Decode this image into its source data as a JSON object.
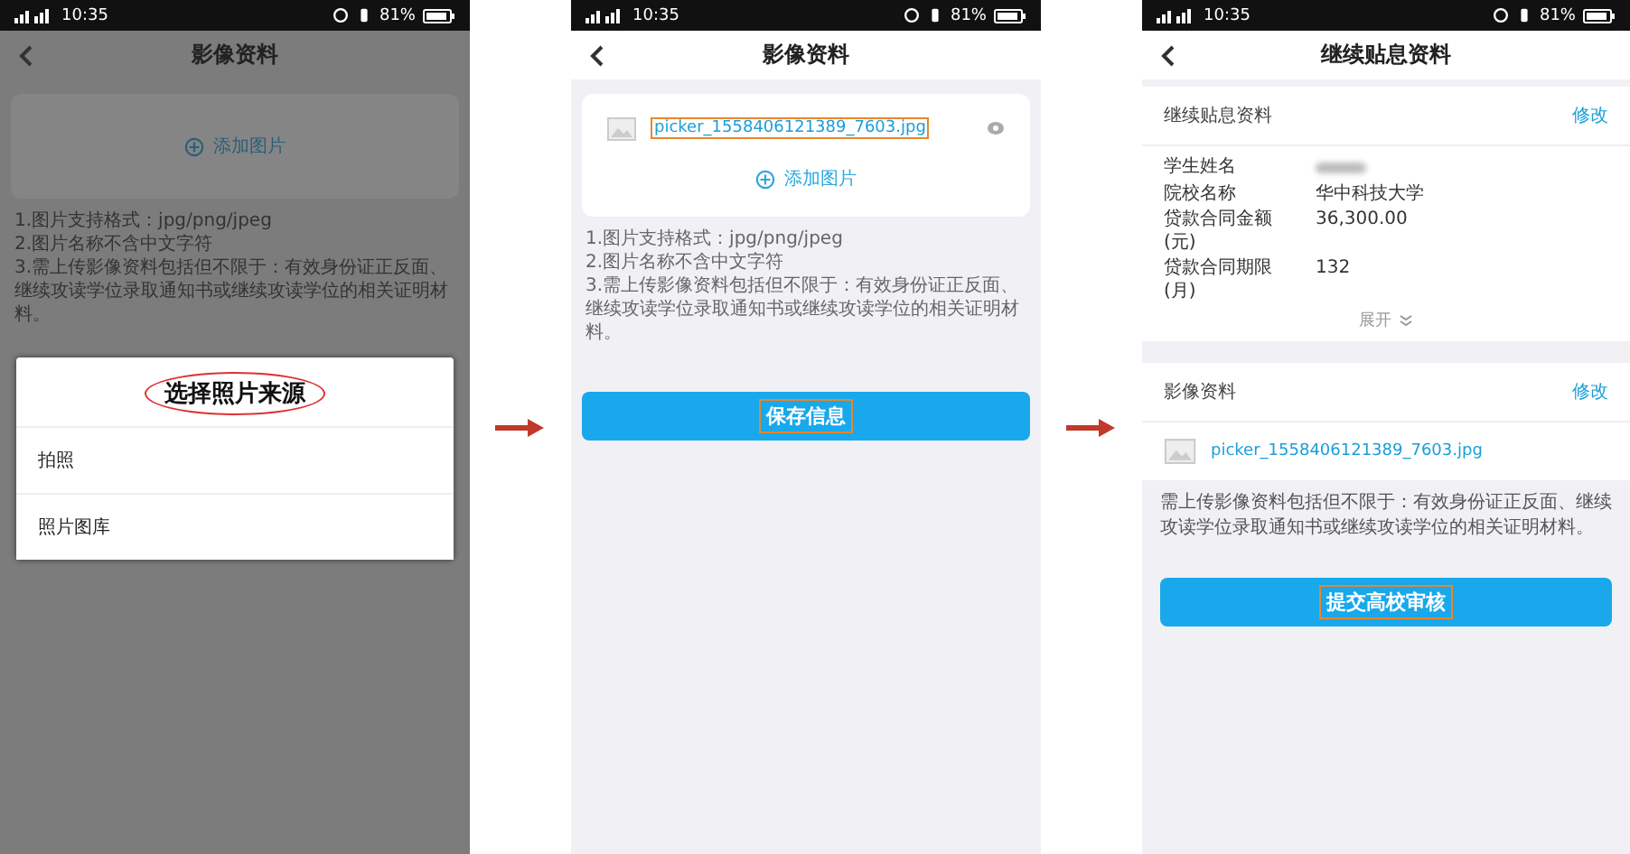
{
  "screens": [
    {
      "kind": "upload",
      "dimmed": true,
      "status_bar": {
        "time": "10:35",
        "battery": "81%"
      },
      "title": "影像资料",
      "add_photo": "添加图片",
      "notes": [
        "1.图片支持格式：jpg/png/jpeg",
        "2.图片名称不含中文字符",
        "3.需上传影像资料包括但不限于：有效身份证正反面、继续攻读学位录取通知书或继续攻读学位的相关证明材料。"
      ],
      "dialog": {
        "title": "选择照片来源",
        "title_circled": true,
        "options": [
          "拍照",
          "照片图库"
        ]
      }
    },
    {
      "kind": "upload",
      "dimmed": false,
      "status_bar": {
        "time": "10:35",
        "battery": "81%"
      },
      "title": "影像资料",
      "files": [
        {
          "name": "picker_1558406121389_7603.jpg",
          "highlighted": true
        }
      ],
      "add_photo": "添加图片",
      "notes": [
        "1.图片支持格式：jpg/png/jpeg",
        "2.图片名称不含中文字符",
        "3.需上传影像资料包括但不限于：有效身份证正反面、继续攻读学位录取通知书或继续攻读学位的相关证明材料。"
      ],
      "button": {
        "label": "保存信息",
        "highlighted": true
      }
    },
    {
      "kind": "summary",
      "status_bar": {
        "time": "10:35",
        "battery": "81%"
      },
      "title": "继续贴息资料",
      "info_section": {
        "heading": "继续贴息资料",
        "action": "修改",
        "fields": [
          {
            "label": "学生姓名",
            "redacted": true
          },
          {
            "label": "院校名称",
            "value": "华中科技大学",
            "redacted": false
          },
          {
            "label": "贷款合同金额(元)",
            "value": "36,300.00",
            "redacted": false
          },
          {
            "label": "贷款合同期限(月)",
            "value": "132",
            "redacted": false
          }
        ],
        "expand": "展开"
      },
      "image_section": {
        "heading": "影像资料",
        "action": "修改",
        "files": [
          {
            "name": "picker_1558406121389_7603.jpg",
            "highlighted": false
          }
        ]
      },
      "note": "需上传影像资料包括但不限于：有效身份证正反面、继续攻读学位录取通知书或继续攻读学位的相关证明材料。",
      "button": {
        "label": "提交高校审核",
        "highlighted": true
      }
    }
  ]
}
